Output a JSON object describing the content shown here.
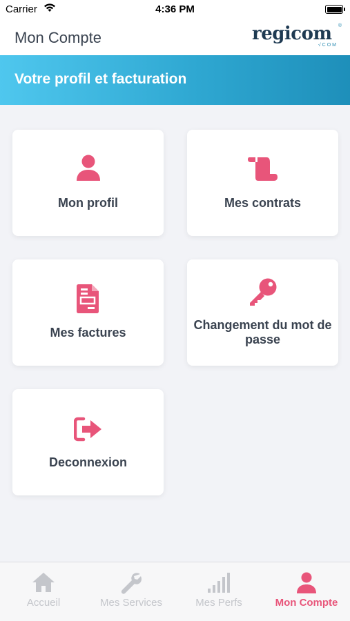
{
  "status_bar": {
    "carrier": "Carrier",
    "time": "4:36 PM"
  },
  "header": {
    "title": "Mon Compte",
    "logo_text": "regicom",
    "logo_tagline": "√COM",
    "logo_reg": "®"
  },
  "banner": {
    "title": "Votre profil et facturation"
  },
  "cards": [
    {
      "label": "Mon profil",
      "icon": "person-icon"
    },
    {
      "label": "Mes contrats",
      "icon": "scroll-icon"
    },
    {
      "label": "Mes factures",
      "icon": "invoice-icon"
    },
    {
      "label": "Changement du mot de passe",
      "icon": "key-icon"
    },
    {
      "label": "Deconnexion",
      "icon": "logout-icon"
    }
  ],
  "tabs": [
    {
      "label": "Accueil",
      "icon": "home-icon",
      "active": false
    },
    {
      "label": "Mes Services",
      "icon": "wrench-icon",
      "active": false
    },
    {
      "label": "Mes Perfs",
      "icon": "signal-bars-icon",
      "active": false
    },
    {
      "label": "Mon Compte",
      "icon": "person-icon",
      "active": true
    }
  ],
  "colors": {
    "accent": "#e8557a",
    "banner_start": "#4fc7ee",
    "banner_end": "#1e8fba",
    "text": "#3a4350",
    "inactive": "#c4c6cb"
  }
}
